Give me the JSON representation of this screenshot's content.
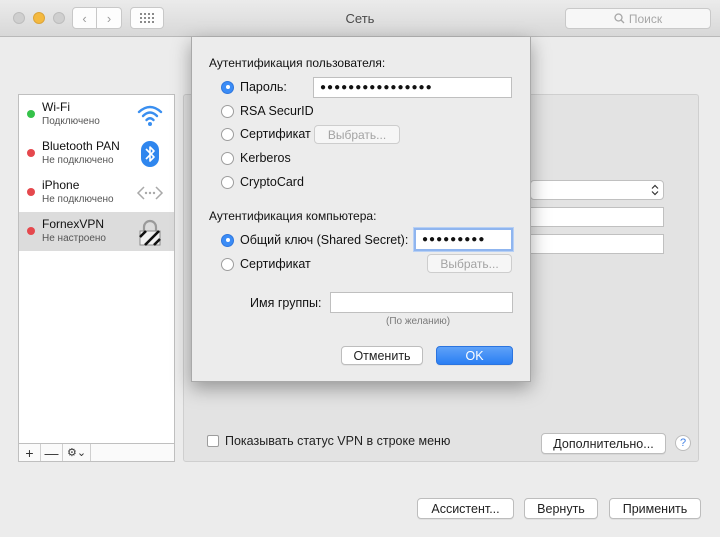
{
  "window": {
    "title": "Сеть",
    "search_placeholder": "Поиск",
    "nav_back": "‹",
    "nav_forward": "›"
  },
  "sidebar": {
    "items": [
      {
        "name": "Wi-Fi",
        "status": "Подключено",
        "status_color": "#35c24a",
        "icon": "wifi-icon"
      },
      {
        "name": "Bluetooth PAN",
        "status": "Не подключено",
        "status_color": "#e5484d",
        "icon": "bluetooth-icon"
      },
      {
        "name": "iPhone",
        "status": "Не подключено",
        "status_color": "#e5484d",
        "icon": "iphone-connection-icon"
      },
      {
        "name": "FornexVPN",
        "status": "Не настроено",
        "status_color": "#e5484d",
        "icon": "vpn-lock-icon"
      }
    ],
    "add": "+",
    "remove": "—",
    "gear": "⚙︎⌄"
  },
  "pane": {
    "show_vpn_status_label": "Показывать статус VPN в строке меню",
    "advanced_button": "Дополнительно...",
    "help": "?"
  },
  "footer": {
    "assistant": "Ассистент...",
    "revert": "Вернуть",
    "apply": "Применить"
  },
  "sheet": {
    "user_auth_title": "Аутентификация пользователя:",
    "user_options": [
      {
        "label": "Пароль:",
        "selected": true
      },
      {
        "label": "RSA SecurID",
        "selected": false
      },
      {
        "label": "Сертификат",
        "selected": false
      },
      {
        "label": "Kerberos",
        "selected": false
      },
      {
        "label": "CryptoCard",
        "selected": false
      }
    ],
    "password_value": "●●●●●●●●●●●●●●●●",
    "select_button": "Выбрать...",
    "computer_auth_title": "Аутентификация компьютера:",
    "computer_options": [
      {
        "label": "Общий ключ (Shared Secret):",
        "selected": true
      },
      {
        "label": "Сертификат",
        "selected": false
      }
    ],
    "shared_secret_value": "●●●●●●●●●",
    "select_button_2": "Выбрать...",
    "group_name_label": "Имя группы:",
    "group_name_value": "",
    "optional_hint": "(По желанию)",
    "cancel": "Отменить",
    "ok": "OK"
  }
}
